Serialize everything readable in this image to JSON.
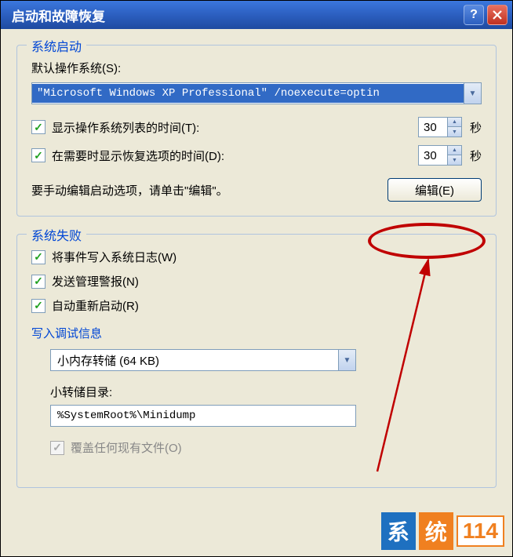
{
  "title": "启动和故障恢复",
  "group1": {
    "title": "系统启动",
    "default_os_label": "默认操作系统(S):",
    "default_os_value": "\"Microsoft Windows XP Professional\" /noexecute=optin",
    "show_os_list_label": "显示操作系统列表的时间(T):",
    "show_os_list_seconds": "30",
    "show_recovery_label": "在需要时显示恢复选项的时间(D):",
    "show_recovery_seconds": "30",
    "seconds_unit": "秒",
    "edit_hint": "要手动编辑启动选项，请单击\"编辑\"。",
    "edit_button": "编辑(E)"
  },
  "group2": {
    "title": "系统失败",
    "write_event_label": "将事件写入系统日志(W)",
    "send_alert_label": "发送管理警报(N)",
    "auto_restart_label": "自动重新启动(R)",
    "debug_title": "写入调试信息",
    "dump_select": "小内存转储 (64 KB)",
    "dump_dir_label": "小转储目录:",
    "dump_dir_value": "%SystemRoot%\\Minidump",
    "overwrite_label": "覆盖任何现有文件(O)"
  },
  "watermark": {
    "a": "系",
    "b": "统",
    "c": "114"
  }
}
